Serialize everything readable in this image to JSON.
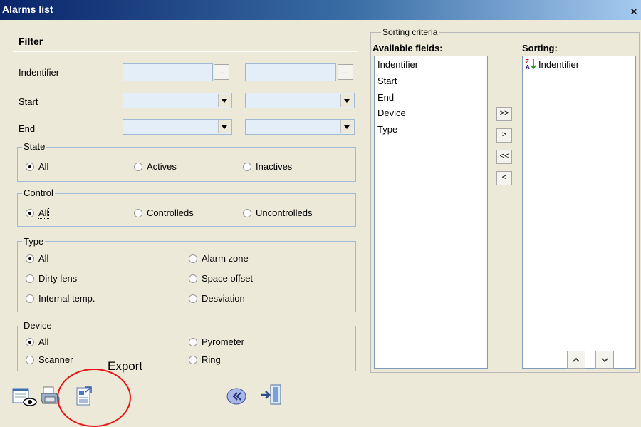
{
  "window": {
    "title": "Alarms list",
    "close_label": "×"
  },
  "filter": {
    "title": "Filter",
    "identifier_label": "Indentifier",
    "start_label": "Start",
    "end_label": "End",
    "browse_label": "...",
    "identifier_from": "",
    "identifier_to": "",
    "start_from": "",
    "start_to": "",
    "end_from": "",
    "end_to": ""
  },
  "state": {
    "title": "State",
    "options": [
      "All",
      "Actives",
      "Inactives"
    ],
    "selected": "All"
  },
  "control": {
    "title": "Control",
    "options": [
      "All",
      "Controlleds",
      "Uncontrolleds"
    ],
    "selected": "All"
  },
  "type": {
    "title": "Type",
    "options": [
      "All",
      "Dirty lens",
      "Internal temp.",
      "Alarm zone",
      "Space offset",
      "Desviation"
    ],
    "selected": "All"
  },
  "device": {
    "title": "Device",
    "options": [
      "All",
      "Scanner",
      "Pyrometer",
      "Ring"
    ],
    "selected": "All"
  },
  "sorting": {
    "legend": "Sorting criteria",
    "available_title": "Available fields:",
    "sorting_title": "Sorting:",
    "available": [
      "Indentifier",
      "Start",
      "End",
      "Device",
      "Type"
    ],
    "selected": [
      "Indentifier"
    ],
    "buttons": {
      "add_all": ">>",
      "add": ">",
      "remove_all": "<<",
      "remove": "<"
    }
  },
  "annotation": {
    "export_label": "Export",
    "circle_color": "#e81616"
  },
  "colors": {
    "background": "#ece9d8",
    "input_fill": "#e4eef8",
    "group_border": "#9fbad4"
  }
}
